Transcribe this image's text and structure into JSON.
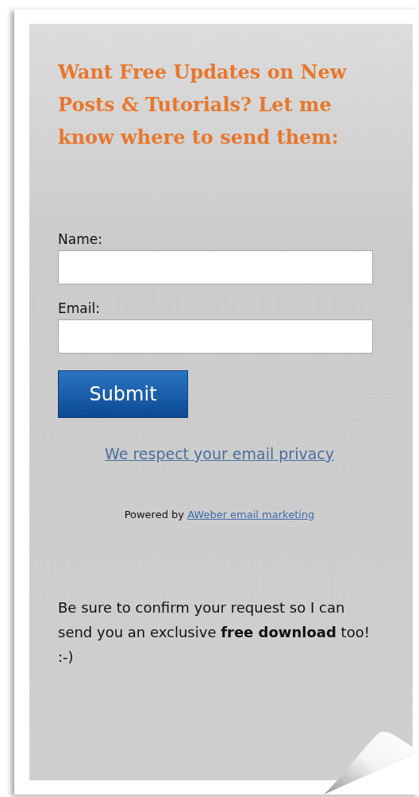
{
  "heading": "Want Free Updates on New Posts & Tutorials? Let me know where to send them:",
  "fields": [
    {
      "label": "Name:"
    },
    {
      "label": "Email:"
    }
  ],
  "submit": "Submit",
  "privacy_link": "We respect your email privacy",
  "powered_by": {
    "text": "Powered by",
    "link": "AWeber email marketing"
  },
  "note": "Be sure to confirm your request so I can send you an exclusive **free download** too! :-)"
}
